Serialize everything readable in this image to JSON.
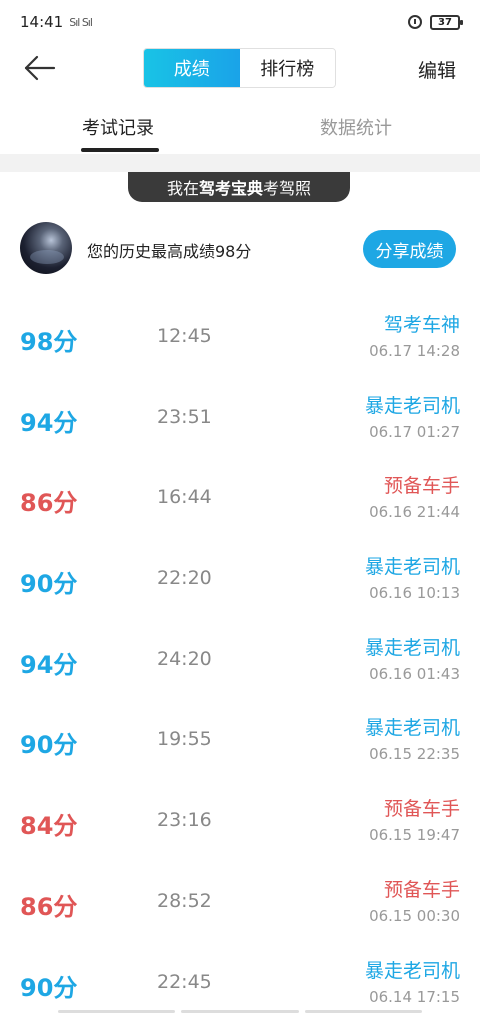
{
  "status_bar": {
    "time": "14:41",
    "signal": "Sıl Sıl",
    "battery": "37"
  },
  "header": {
    "segments": [
      "成绩",
      "排行榜"
    ],
    "edit_label": "编辑"
  },
  "subtabs": [
    "考试记录",
    "数据统计"
  ],
  "promo": {
    "prefix": "我在",
    "brand": "驾考宝典",
    "suffix": "考驾照"
  },
  "best": {
    "text": "您的历史最高成绩98分",
    "share_label": "分享成绩"
  },
  "colors": {
    "accent_blue": "#1ea7e4",
    "fail_red": "#e05656"
  },
  "records": [
    {
      "score": "98分",
      "duration": "12:45",
      "title": "驾考车神",
      "time": "06.17  14:28",
      "pass": true
    },
    {
      "score": "94分",
      "duration": "23:51",
      "title": "暴走老司机",
      "time": "06.17  01:27",
      "pass": true
    },
    {
      "score": "86分",
      "duration": "16:44",
      "title": "预备车手",
      "time": "06.16  21:44",
      "pass": false
    },
    {
      "score": "90分",
      "duration": "22:20",
      "title": "暴走老司机",
      "time": "06.16  10:13",
      "pass": true
    },
    {
      "score": "94分",
      "duration": "24:20",
      "title": "暴走老司机",
      "time": "06.16  01:43",
      "pass": true
    },
    {
      "score": "90分",
      "duration": "19:55",
      "title": "暴走老司机",
      "time": "06.15  22:35",
      "pass": true
    },
    {
      "score": "84分",
      "duration": "23:16",
      "title": "预备车手",
      "time": "06.15  19:47",
      "pass": false
    },
    {
      "score": "86分",
      "duration": "28:52",
      "title": "预备车手",
      "time": "06.15  00:30",
      "pass": false
    },
    {
      "score": "90分",
      "duration": "22:45",
      "title": "暴走老司机",
      "time": "06.14  17:15",
      "pass": true
    }
  ]
}
